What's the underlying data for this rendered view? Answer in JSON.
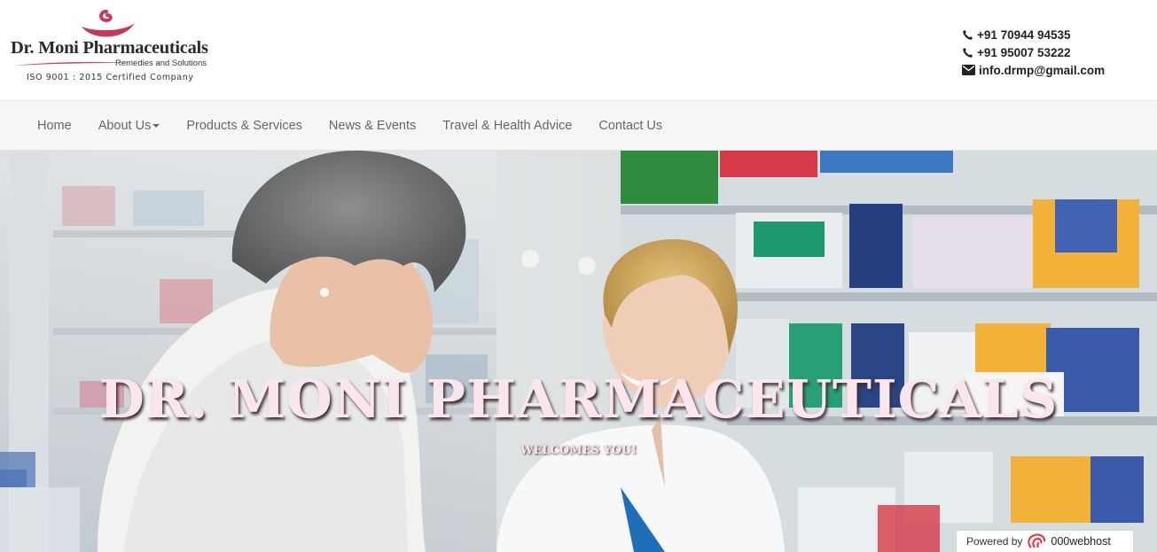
{
  "brand": {
    "name": "Dr. Moni Pharmaceuticals",
    "tagline": "Remedies and Solutions",
    "certification": "ISO 9001 : 2015 Certified Company",
    "colors": {
      "accent": "#c8385a",
      "text": "#2b2b2b"
    }
  },
  "contact": {
    "phone1": "+91 70944 94535",
    "phone2": "+91 95007 53222",
    "email": "info.drmp@gmail.com"
  },
  "nav": {
    "items": [
      {
        "label": "Home"
      },
      {
        "label": "About Us",
        "dropdown": true
      },
      {
        "label": "Products & Services"
      },
      {
        "label": "News & Events"
      },
      {
        "label": "Travel & Health Advice"
      },
      {
        "label": "Contact Us"
      }
    ]
  },
  "hero": {
    "title": "DR. MONI PHARMACEUTICALS",
    "subtitle": "WELCOMES YOU!"
  },
  "footer_badge": {
    "prefix": "Powered by",
    "brand": "000webhost"
  },
  "icons": {
    "phone": "phone-icon",
    "email": "envelope-icon",
    "host": "000webhost-logo-icon"
  }
}
